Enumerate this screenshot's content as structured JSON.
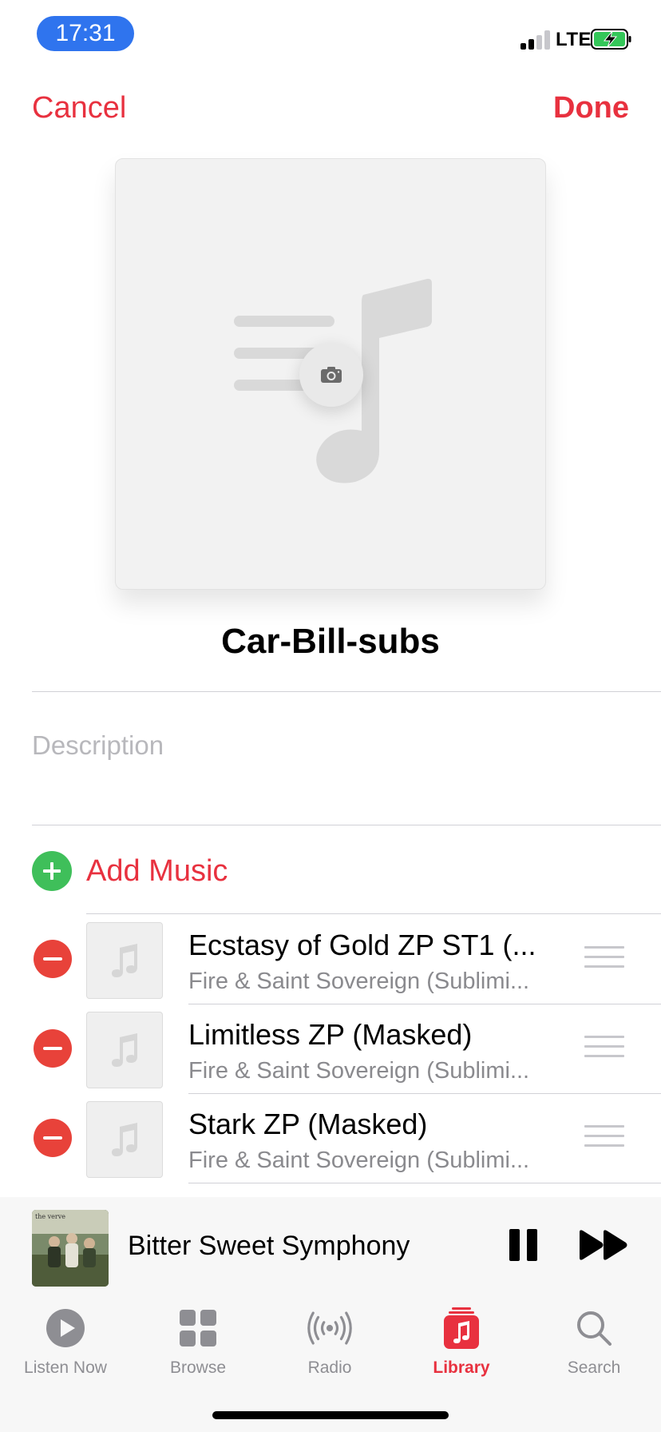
{
  "status_bar": {
    "time": "17:31",
    "network": "LTE",
    "accent": "#2f74ee"
  },
  "nav": {
    "cancel_label": "Cancel",
    "done_label": "Done",
    "accent": "#e8313f"
  },
  "artwork": {
    "placeholder_icon": "music-note-icon",
    "camera_icon": "camera-icon"
  },
  "playlist": {
    "title": "Car-Bill-subs",
    "description_placeholder": "Description",
    "add_music_label": "Add Music"
  },
  "songs": [
    {
      "title": "Ecstasy of Gold ZP ST1 (...",
      "artist": "Fire & Saint Sovereign (Sublimi..."
    },
    {
      "title": "Limitless ZP (Masked)",
      "artist": "Fire & Saint Sovereign (Sublimi..."
    },
    {
      "title": "Stark ZP (Masked)",
      "artist": "Fire & Saint Sovereign (Sublimi..."
    }
  ],
  "mini_player": {
    "track_title": "Bitter Sweet Symphony",
    "art_text": "the verve",
    "state": "playing"
  },
  "tabs": [
    {
      "label": "Listen Now",
      "icon": "play-circle-icon",
      "active": false
    },
    {
      "label": "Browse",
      "icon": "grid-icon",
      "active": false
    },
    {
      "label": "Radio",
      "icon": "radio-waves-icon",
      "active": false
    },
    {
      "label": "Library",
      "icon": "library-icon",
      "active": true
    },
    {
      "label": "Search",
      "icon": "search-icon",
      "active": false
    }
  ]
}
